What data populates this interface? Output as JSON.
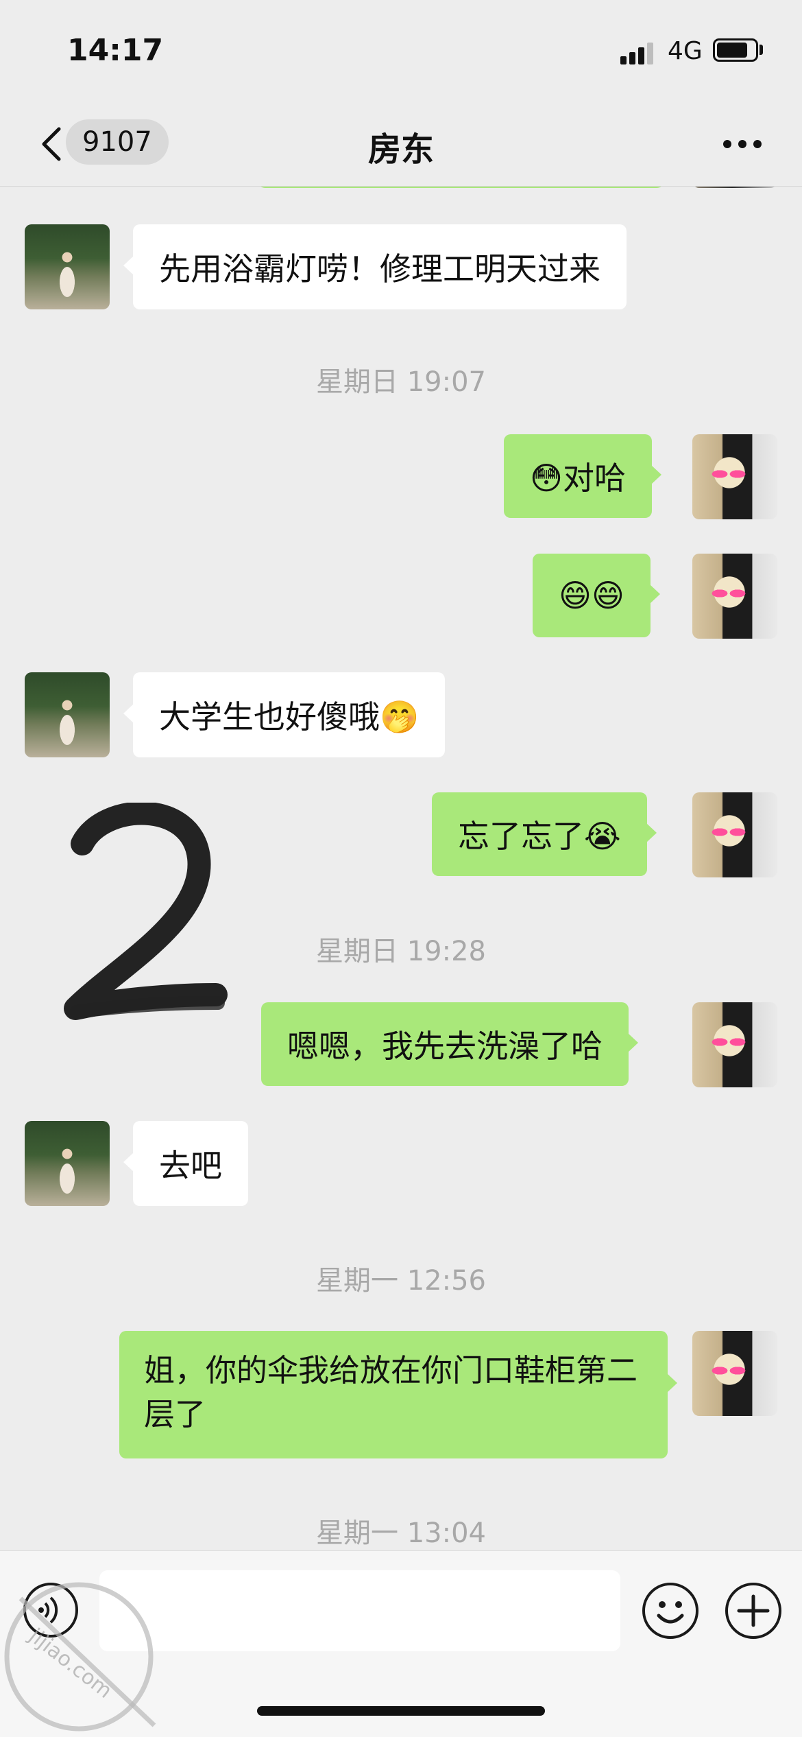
{
  "status_bar": {
    "time": "14:17",
    "network": "4G"
  },
  "nav": {
    "unread_count": "9107",
    "title": "房东"
  },
  "messages": [
    {
      "side": "left",
      "text": "先用浴霸灯唠！修理工明天过来"
    },
    {
      "type": "time",
      "text": "星期日 19:07"
    },
    {
      "side": "right",
      "text": "😳对哈"
    },
    {
      "side": "right",
      "text": "😄😄"
    },
    {
      "side": "left",
      "text": "大学生也好傻哦🤭"
    },
    {
      "side": "right",
      "text": "忘了忘了😭"
    },
    {
      "type": "time",
      "text": "星期日 19:28"
    },
    {
      "side": "right",
      "text": "嗯嗯，我先去洗澡了哈"
    },
    {
      "side": "left",
      "text": "去吧"
    },
    {
      "type": "time",
      "text": "星期一 12:56"
    },
    {
      "side": "right",
      "text": "姐，你的伞我给放在你门口鞋柜第二层了"
    },
    {
      "type": "time",
      "text": "星期一 13:04"
    }
  ],
  "overlay": {
    "scribble_digit": "2",
    "watermark_text": "jijiao.com"
  },
  "icons": {
    "back": "chevron-left-icon",
    "more": "more-dots-icon",
    "voice": "voice-icon",
    "emoji": "emoji-icon",
    "plus": "plus-icon"
  },
  "colors": {
    "sent_bubble": "#a9e87a",
    "received_bubble": "#ffffff",
    "background": "#ededed"
  }
}
